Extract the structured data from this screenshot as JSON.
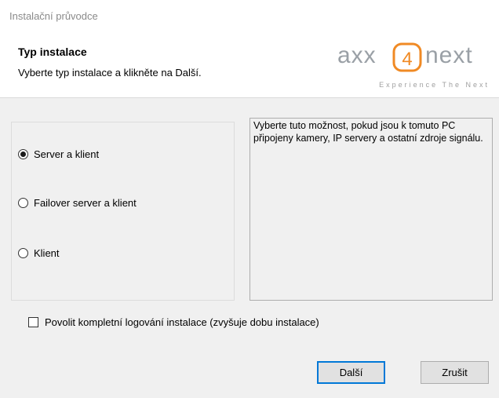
{
  "window": {
    "title": "Instalační průvodce"
  },
  "header": {
    "title": "Typ instalace",
    "subtitle": "Vyberte typ instalace a klikněte na Další.",
    "logo": {
      "brand_left": "axx",
      "brand_digit": "4",
      "brand_right": "next",
      "tagline": "Experience The Next",
      "accent_color": "#f08a24"
    }
  },
  "install_type": {
    "options": [
      {
        "label": "Server a klient",
        "selected": true
      },
      {
        "label": "Failover server a klient",
        "selected": false
      },
      {
        "label": "Klient",
        "selected": false
      }
    ],
    "description": "Vyberte tuto možnost, pokud jsou k tomuto PC připojeny kamery, IP servery a ostatní zdroje signálu."
  },
  "logging_checkbox": {
    "label": "Povolit kompletní logování instalace (zvyšuje dobu instalace)",
    "checked": false
  },
  "buttons": {
    "next": "Další",
    "cancel": "Zrušit"
  },
  "colors": {
    "focus_border": "#0078d7",
    "dialog_bg": "#f0f0f0"
  }
}
